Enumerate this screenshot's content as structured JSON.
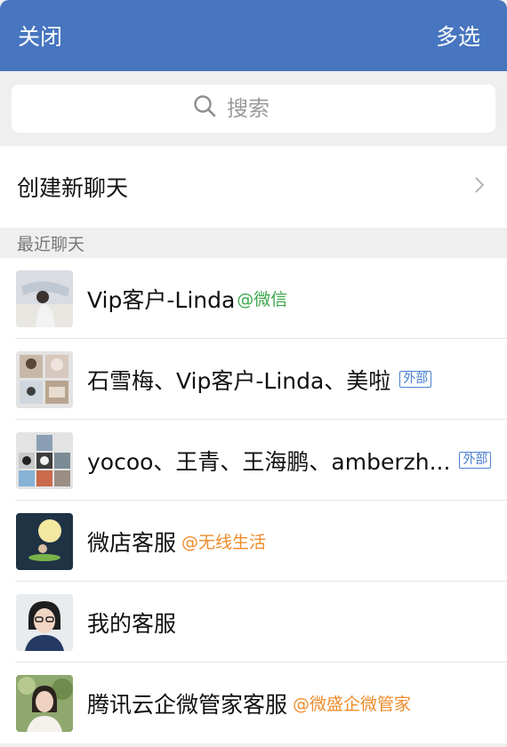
{
  "header": {
    "close_label": "关闭",
    "multi_select_label": "多选"
  },
  "search": {
    "placeholder": "搜索"
  },
  "new_chat": {
    "label": "创建新聊天"
  },
  "recent": {
    "header": "最近聊天",
    "items": [
      {
        "name": "Vip客户-Linda",
        "tag": "@微信",
        "tag_color": "#3aa64a"
      },
      {
        "name": "石雪梅、Vip客户-Linda、美啦",
        "badge": "外部"
      },
      {
        "name": "yocoo、王青、王海鹏、amberzh...",
        "badge": "外部"
      },
      {
        "name": "微店客服",
        "tag": "@无线生活",
        "tag_color": "#ee8b2b"
      },
      {
        "name": "我的客服"
      },
      {
        "name": "腾讯云企微管家客服",
        "tag": "@微盛企微管家",
        "tag_color": "#ee8b2b"
      }
    ]
  },
  "colors": {
    "header_bg": "#4775bf",
    "badge_blue": "#4a7fd0"
  },
  "icons": {
    "search": "search-icon",
    "chevron": "chevron-right-icon"
  }
}
